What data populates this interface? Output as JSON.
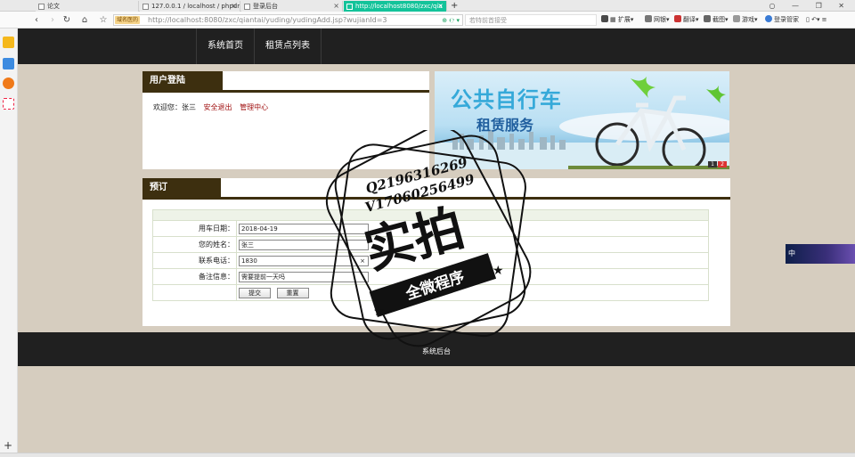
{
  "tabs": [
    {
      "label": "论文"
    },
    {
      "label": "127.0.0.1 / localhost / phpdr"
    },
    {
      "label": "登录后台"
    },
    {
      "label": "http://localhost8080/zxc/qia"
    }
  ],
  "toolbar": {
    "secure_tag": "域名医的",
    "url": "http://localhost:8080/zxc/qiantai/yuding/yudingAdd.jsp?wujianId=3",
    "search_placeholder": "若特前首接受",
    "items": [
      "扩展",
      "网银",
      "翻译",
      "截图",
      "游戏",
      "登录管家"
    ]
  },
  "nav": {
    "home": "系统首页",
    "list": "租赁点列表"
  },
  "login_panel": {
    "title": "用户登陆",
    "welcome": "欢迎您：张三",
    "logout": "安全退出",
    "manage": "管理中心"
  },
  "banner": {
    "title": "公共自行车",
    "subtitle": "租赁服务",
    "pages": [
      "1",
      "2"
    ]
  },
  "booking": {
    "title": "预订",
    "fields": {
      "date_label": "用车日期：",
      "date_value": "2018-04-19",
      "name_label": "您的姓名：",
      "name_value": "张三",
      "phone_label": "联系电话：",
      "phone_value": "1830",
      "note_label": "备注信息：",
      "note_value": "需要提前一天吗"
    },
    "submit": "提交",
    "reset": "重置"
  },
  "footer": {
    "admin_link": "系统后台"
  },
  "floater": {
    "text": "中"
  },
  "watermark": {
    "qq": "Q2196316269",
    "vx": "V17060256499",
    "big": "实拍",
    "badge": "全微程序"
  }
}
